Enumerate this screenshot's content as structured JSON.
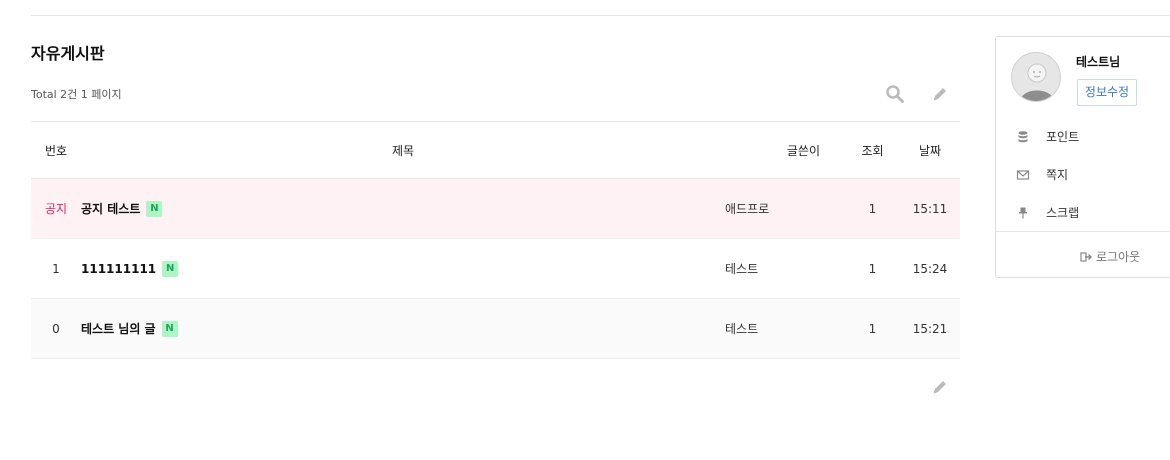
{
  "board": {
    "title": "자유게시판",
    "total": "Total 2건 1 페이지",
    "columns": {
      "num": "번호",
      "subject": "제목",
      "writer": "글쓴이",
      "hits": "조회",
      "date": "날짜"
    },
    "rows": [
      {
        "num": "공지",
        "subject": "공지 테스트",
        "badge": "N",
        "writer": "애드프로",
        "hits": "1",
        "date": "15:11",
        "notice": true
      },
      {
        "num": "1",
        "subject": "111111111",
        "badge": "N",
        "writer": "테스트",
        "hits": "1",
        "date": "15:24",
        "notice": false
      },
      {
        "num": "0",
        "subject": "테스트 님의 글",
        "badge": "N",
        "writer": "테스트",
        "hits": "1",
        "date": "15:21",
        "notice": false
      }
    ],
    "icons": {
      "search": "search-icon",
      "write": "pencil-icon"
    }
  },
  "profile": {
    "nickname": "테스트님",
    "edit_label": "정보수정",
    "menu": [
      {
        "label": "포인트",
        "icon": "database-icon"
      },
      {
        "label": "쪽지",
        "icon": "envelope-icon"
      },
      {
        "label": "스크랩",
        "icon": "thumbtack-icon"
      }
    ],
    "logout_label": "로그아웃"
  },
  "colors": {
    "notice_bg": "#fff2f5",
    "notice_text": "#e0245e",
    "new_badge_bg": "#adf5c5",
    "new_badge_text": "#1fa55a",
    "link_blue": "#3a78c8"
  }
}
